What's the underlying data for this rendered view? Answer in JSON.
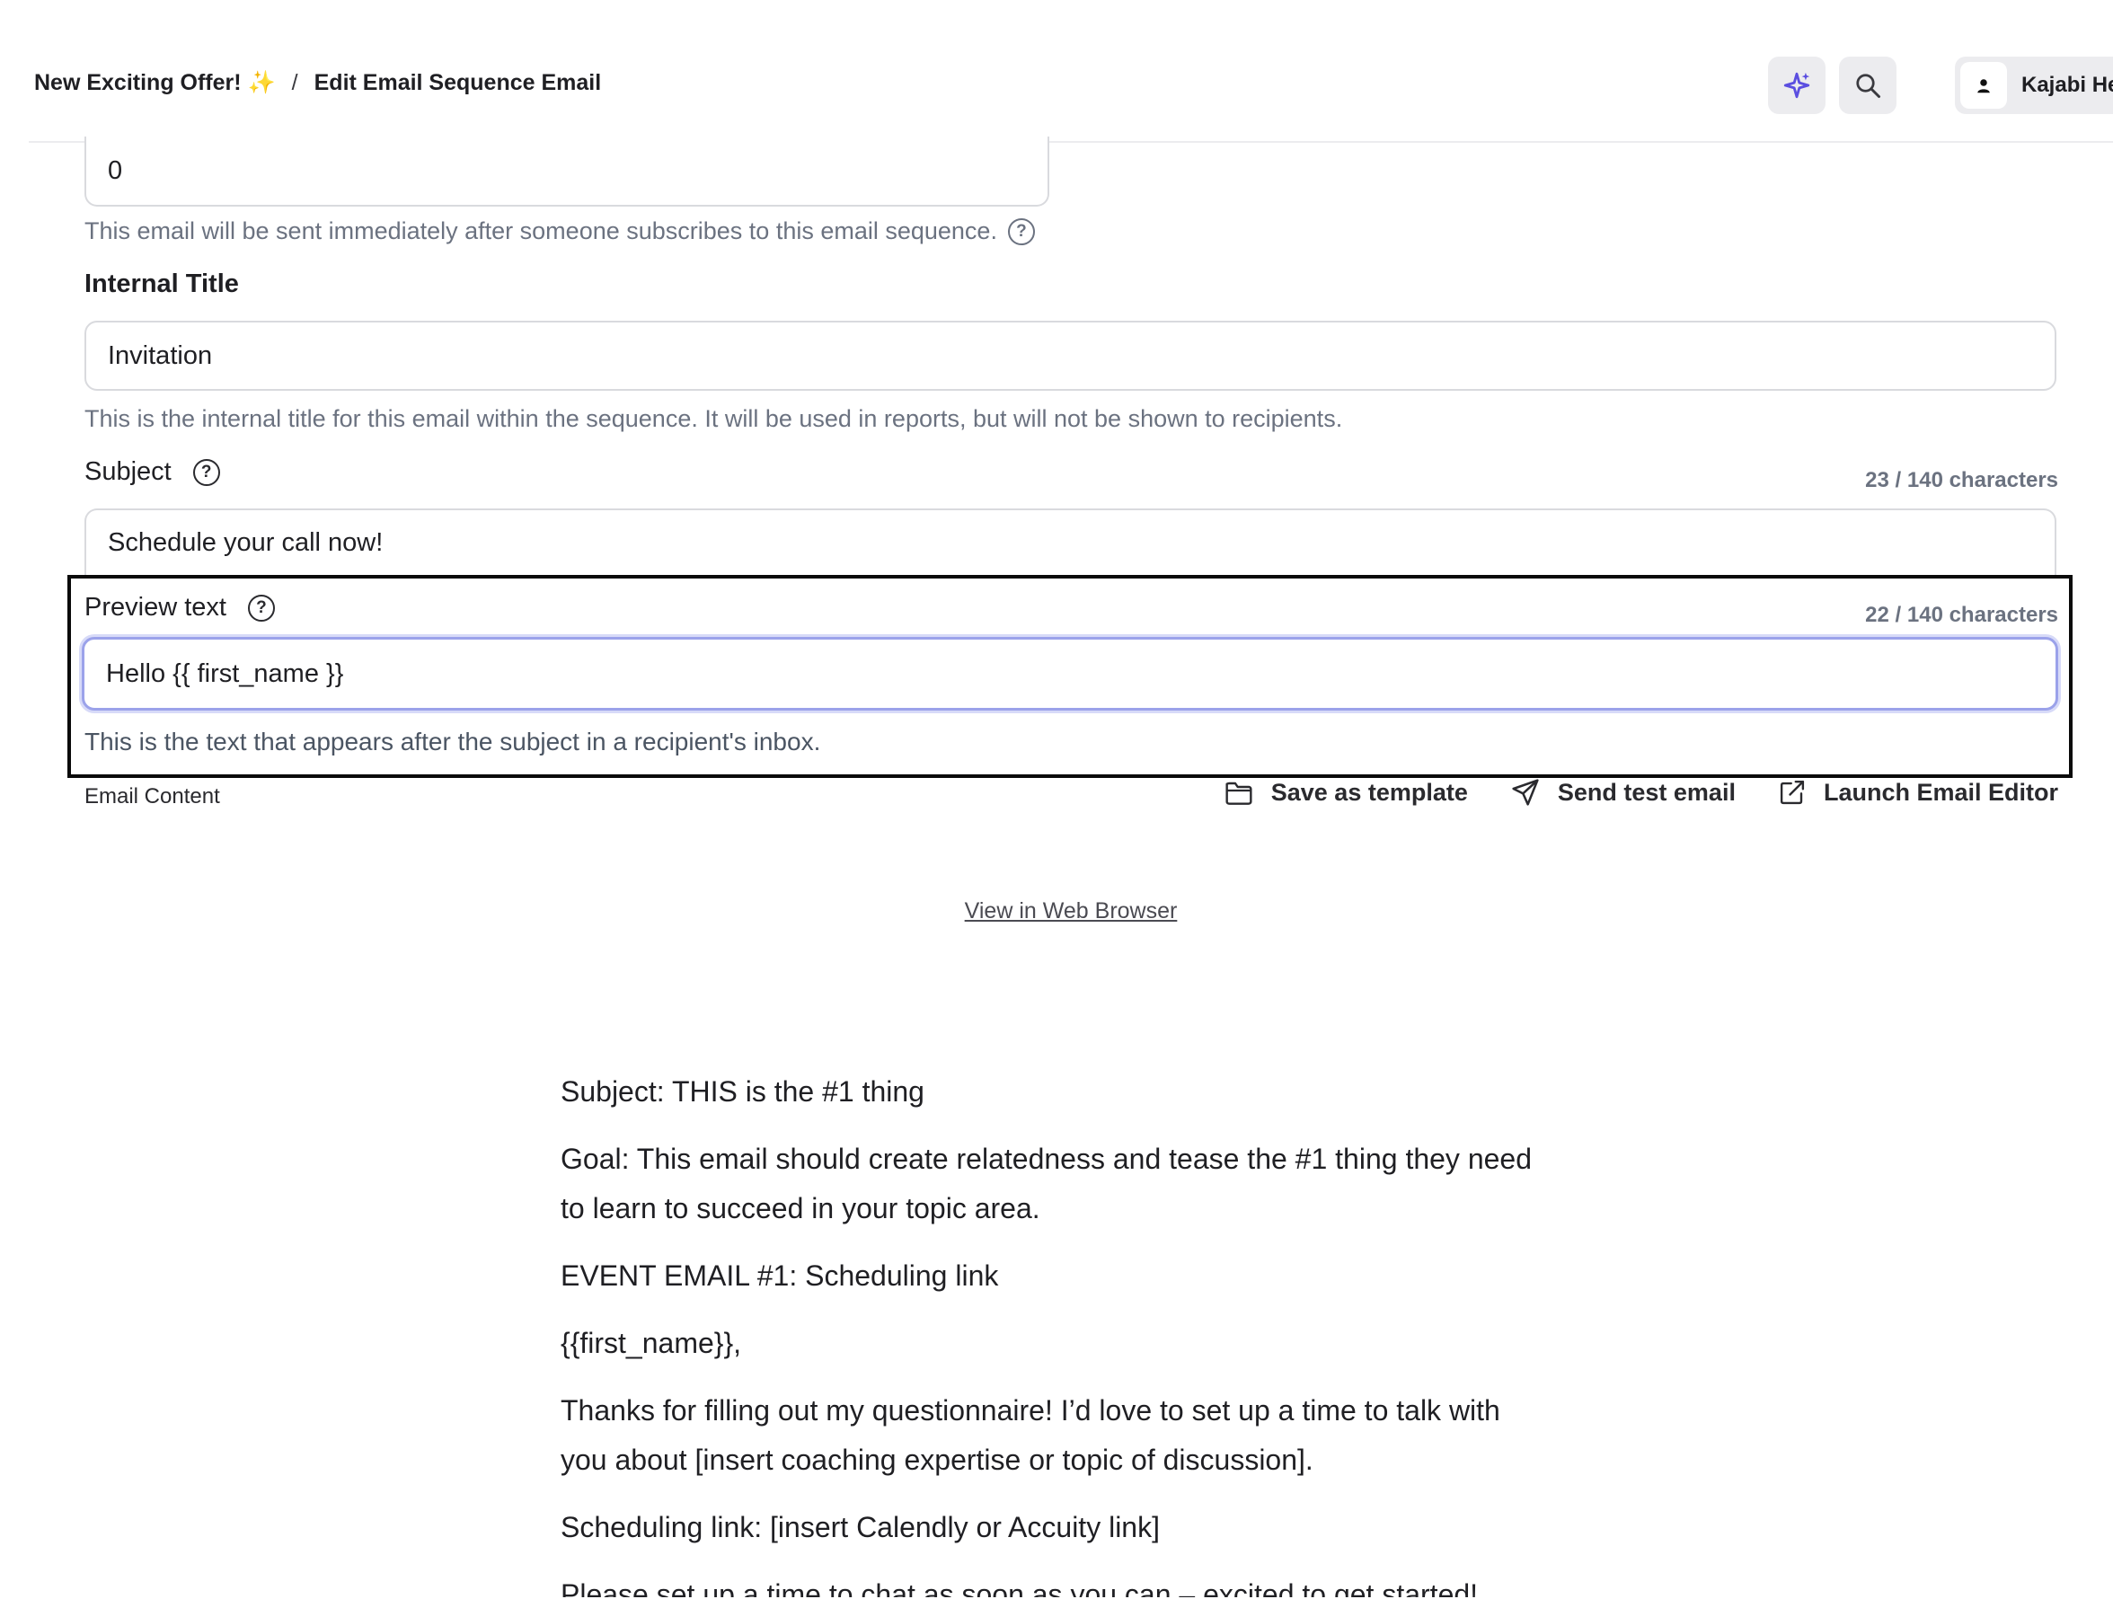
{
  "header": {
    "breadcrumb_parent": "New Exciting Offer! ✨",
    "breadcrumb_separator": "/",
    "breadcrumb_current": "Edit Email Sequence Email",
    "user_name": "Kajabi Hel"
  },
  "form": {
    "delay_value": "0",
    "delay_help": "This email will be sent immediately after someone subscribes to this email sequence.",
    "internal_title_label": "Internal Title",
    "internal_title_value": "Invitation",
    "internal_title_help": "This is the internal title for this email within the sequence. It will be used in reports, but will not be shown to recipients.",
    "subject_label": "Subject",
    "subject_counter": "23 / 140 characters",
    "subject_value": "Schedule your call now!",
    "preview_label": "Preview text",
    "preview_counter": "22 / 140 characters",
    "preview_value": "Hello {{ first_name }}",
    "preview_help": "This is the text that appears after the subject in a recipient's inbox."
  },
  "content": {
    "label": "Email Content",
    "save_template": "Save as template",
    "send_test": "Send test email",
    "launch_editor": "Launch Email Editor",
    "view_browser": "View in Web Browser"
  },
  "email": {
    "paragraphs": [
      "Subject: THIS is the #1 thing",
      "Goal: This email should create relatedness and tease the #1 thing they need to learn to succeed in your topic area.",
      "EVENT EMAIL #1: Scheduling link",
      "{{first_name}},",
      "Thanks for filling out my questionnaire! I’d love to set up a time to talk with you about [insert coaching expertise or topic of discussion].",
      "Scheduling link: [insert Calendly or Accuity link]",
      "Please set up a time to chat as soon as you can – excited to get started!"
    ]
  },
  "colors": {
    "accent": "#5b4ee0",
    "focus_ring": "#9ba2ea",
    "muted_text": "#6b7280"
  },
  "icons": [
    "sparkle-icon",
    "search-icon",
    "user-icon",
    "question-icon",
    "folder-icon",
    "send-icon",
    "external-link-icon"
  ]
}
